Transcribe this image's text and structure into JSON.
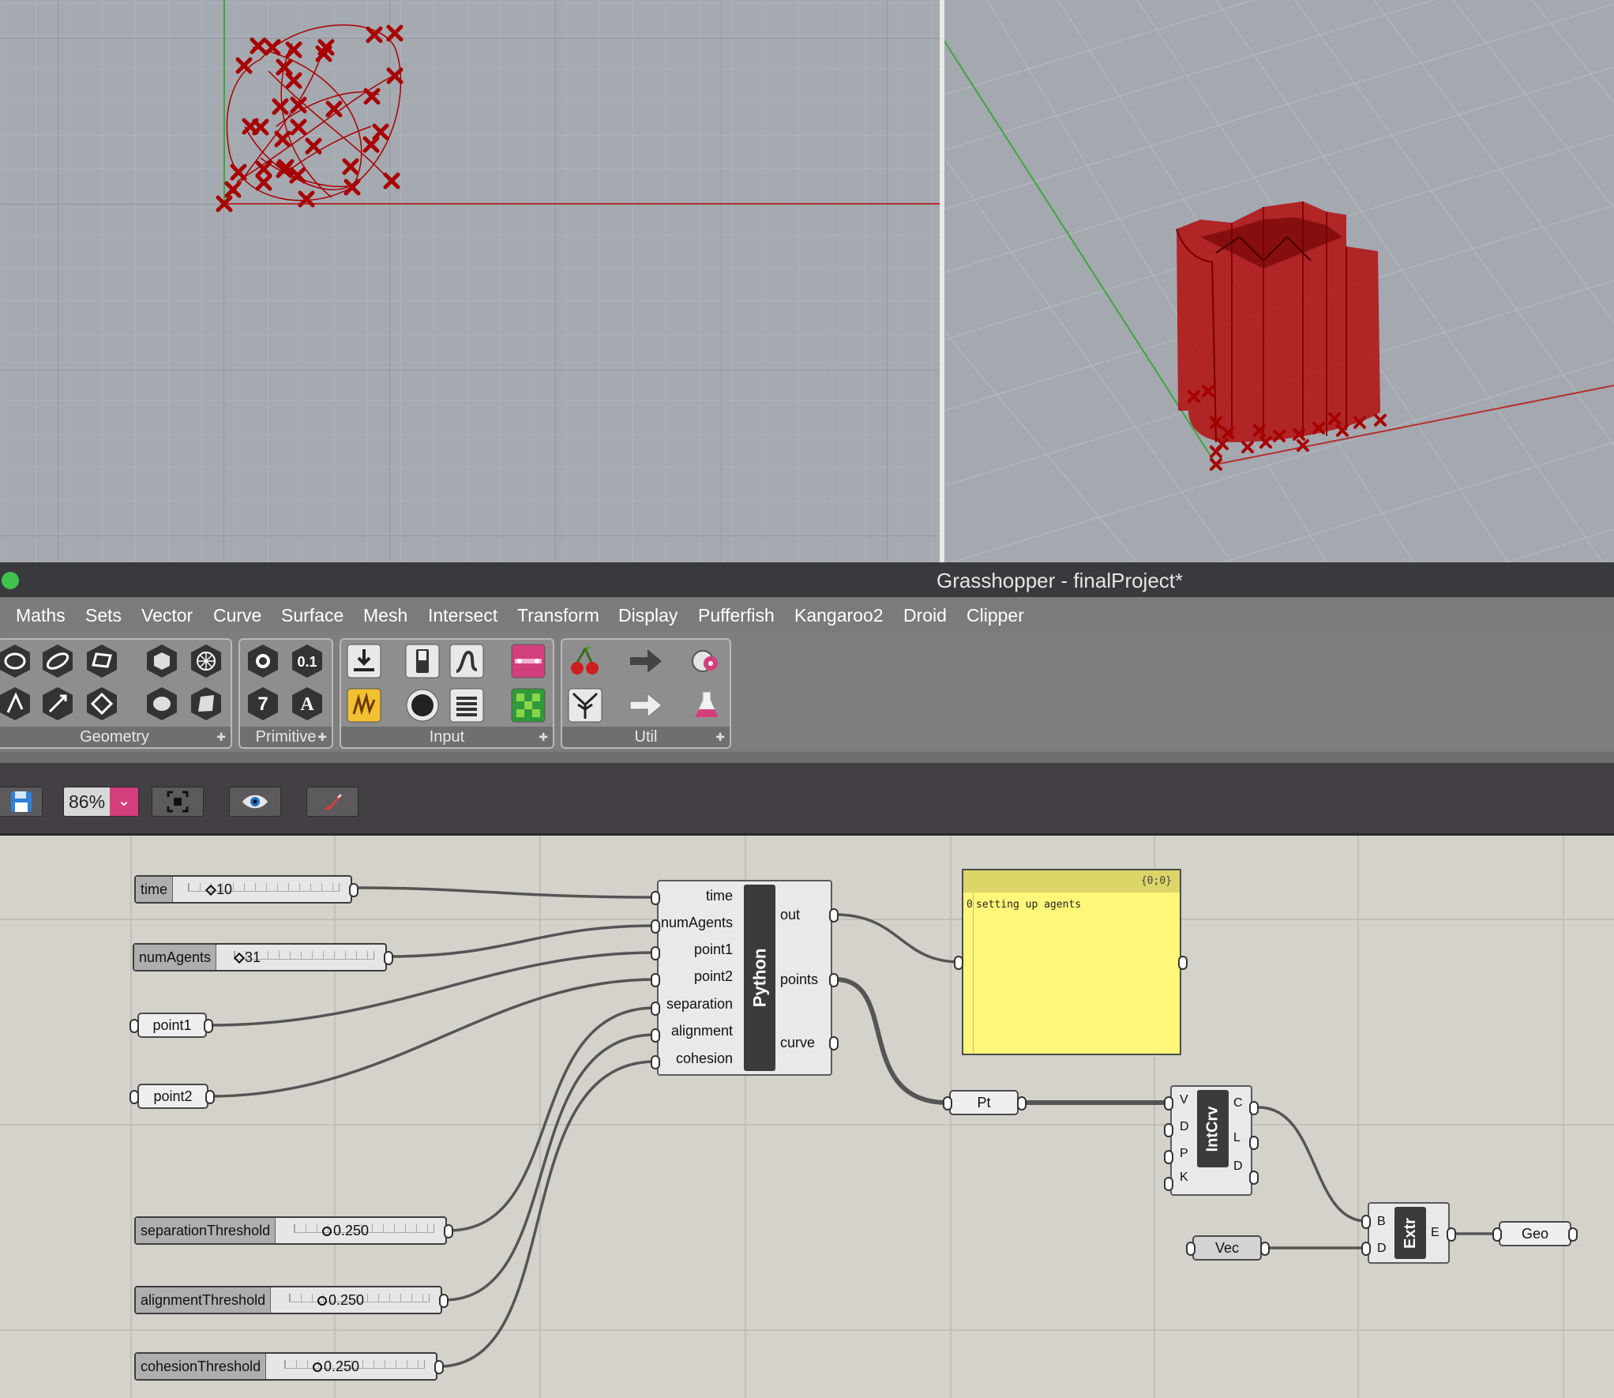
{
  "window": {
    "title": "Grasshopper - finalProject*"
  },
  "tabs": [
    "Maths",
    "Sets",
    "Vector",
    "Curve",
    "Surface",
    "Mesh",
    "Intersect",
    "Transform",
    "Display",
    "Pufferfish",
    "Kangaroo2",
    "Droid",
    "Clipper"
  ],
  "ribbon_panels": {
    "geometry": "Geometry",
    "primitive": "Primitive",
    "input": "Input",
    "util": "Util"
  },
  "ribbon_icons": {
    "geometry": [
      "circle-icon",
      "ellipse-icon",
      "rectangle-icon",
      "box-icon",
      "mesh-sphere-icon",
      "line-icon",
      "vector-icon",
      "plane-icon",
      "cylinder-icon",
      "surface-icon"
    ],
    "primitive": [
      "circle-param-icon",
      "number-icon",
      "integer-icon",
      "text-icon"
    ],
    "input": [
      "import-icon",
      "toggle-icon",
      "slider-icon",
      "button-icon",
      "graph-mapper-icon",
      "value-list-icon",
      "gradient-icon",
      "colour-swatch-icon"
    ],
    "util": [
      "cherry-icon",
      "arrow-right-icon",
      "tree-icon",
      "relay-icon",
      "fitness-icon",
      "flask-icon"
    ]
  },
  "primitive_glyphs": {
    "number": "0.1",
    "integer": "7",
    "text": "A"
  },
  "toolbar": {
    "zoom": "86%",
    "icons": [
      "save-icon",
      "zoom-dropdown-icon",
      "zoom-extents-icon",
      "preview-eye-icon",
      "sketch-brush-icon"
    ]
  },
  "sliders": {
    "time": {
      "label": "time",
      "value": "10"
    },
    "numAgents": {
      "label": "numAgents",
      "value": "31"
    },
    "separationThreshold": {
      "label": "separationThreshold",
      "value": "0.250"
    },
    "alignmentThreshold": {
      "label": "alignmentThreshold",
      "value": "0.250"
    },
    "cohesionThreshold": {
      "label": "cohesionThreshold",
      "value": "0.250"
    }
  },
  "params": {
    "point1": "point1",
    "point2": "point2",
    "pt": "Pt",
    "vec": "Vec",
    "geo": "Geo"
  },
  "python_component": {
    "name": "Python",
    "inputs": [
      "time",
      "numAgents",
      "point1",
      "point2",
      "separation",
      "alignment",
      "cohesion"
    ],
    "outputs": [
      "out",
      "points",
      "curve"
    ]
  },
  "intcrv_component": {
    "name": "IntCrv",
    "inputs": [
      "V",
      "D",
      "P",
      "K"
    ],
    "outputs": [
      "C",
      "L",
      "D"
    ]
  },
  "extr_component": {
    "name": "Extr",
    "inputs": [
      "B",
      "D"
    ],
    "outputs": [
      "E"
    ]
  },
  "panel": {
    "path": "{0;0}",
    "index": "0",
    "text": "setting up agents"
  },
  "colors": {
    "accent": "#d23f7c",
    "geometry": "#b10000",
    "canvas": "#d5d2cb",
    "panel": "#fff77a"
  }
}
